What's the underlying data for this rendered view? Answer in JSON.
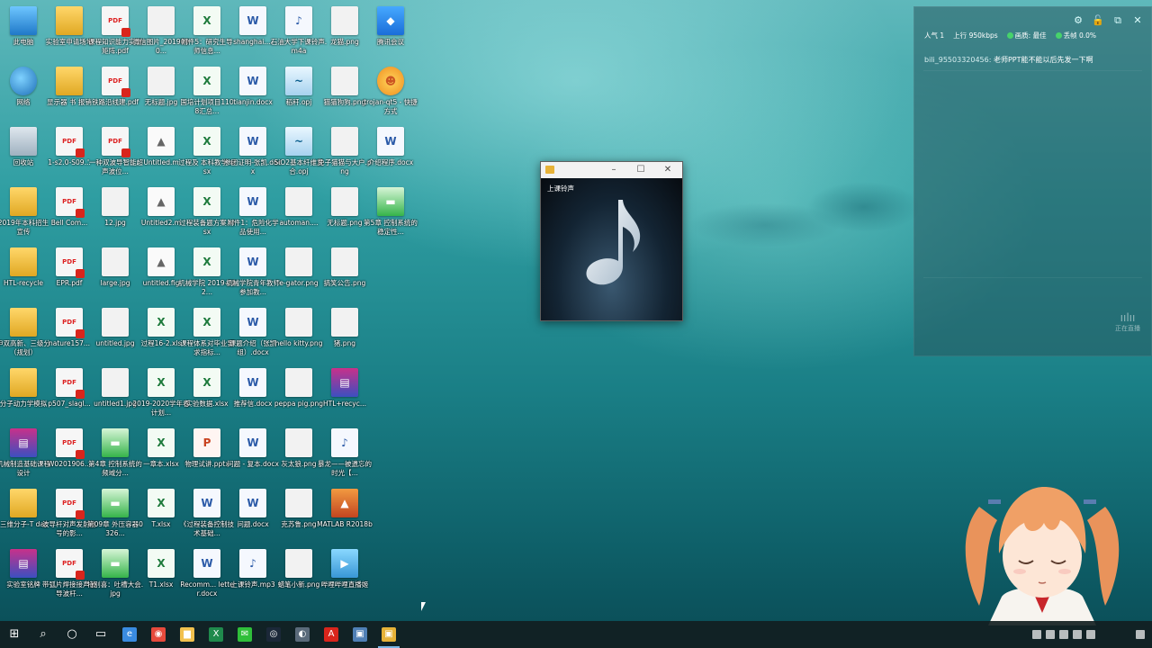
{
  "desktop": {
    "icons": [
      [
        {
          "label": "此电脑",
          "type": "pc"
        },
        {
          "label": "实验室申请场地",
          "type": "folder"
        },
        {
          "label": "课程知识能力实现矩阵.pdf",
          "type": "pdf"
        },
        {
          "label": "微信图片_2019090...",
          "type": "img"
        },
        {
          "label": "附件5：研究生导师信息...",
          "type": "xls"
        },
        {
          "label": "shanghai....",
          "type": "doc"
        },
        {
          "label": "石油大学下课铃声.m4a",
          "type": "audio"
        },
        {
          "label": "龙猫.png",
          "type": "img"
        },
        {
          "label": "腾讯会议",
          "type": "meeting"
        }
      ],
      [
        {
          "label": "网络",
          "type": "net"
        },
        {
          "label": "显示器 书 报销",
          "type": "folder"
        },
        {
          "label": "铁路沿线建.pdf",
          "type": "pdf"
        },
        {
          "label": "无标题.jpg",
          "type": "img"
        },
        {
          "label": "国培计划项目1108汇总...",
          "type": "xls"
        },
        {
          "label": "tianjin.docx",
          "type": "doc"
        },
        {
          "label": "稻秆.opj",
          "type": "opj"
        },
        {
          "label": "猫猫狗狗.png",
          "type": "img"
        },
        {
          "label": "trojan-qt5 - 快捷方式",
          "type": "trojan"
        }
      ],
      [
        {
          "label": "回收站",
          "type": "bin"
        },
        {
          "label": "1-s2.0-S09...",
          "type": "pdf"
        },
        {
          "label": "'一种双波导智能超声波位...",
          "type": "pdf"
        },
        {
          "label": "Untitled.m",
          "type": "matlabfile"
        },
        {
          "label": "过程及 本科教学.xlsx",
          "type": "xls"
        },
        {
          "label": "参团证明-张凯.docx",
          "type": "doc"
        },
        {
          "label": "SiO2基本纤维复合.opj",
          "type": "opj"
        },
        {
          "label": "免子猫猫与大户.png",
          "type": "img"
        },
        {
          "label": "介绍程序.docx",
          "type": "doc"
        }
      ],
      [
        {
          "label": "2019年本科招生宣传",
          "type": "folder"
        },
        {
          "label": "Bell Com...",
          "type": "pdf"
        },
        {
          "label": "12.jpg",
          "type": "img"
        },
        {
          "label": "Untitled2.m",
          "type": "matlabfile"
        },
        {
          "label": "过程装备题方案.xlsx",
          "type": "xls"
        },
        {
          "label": "附件1：危险化学品使用...",
          "type": "doc"
        },
        {
          "label": "automan....",
          "type": "img"
        },
        {
          "label": "无标题.png",
          "type": "img"
        },
        {
          "label": "第5章 控制系统的稳定性...",
          "type": "green"
        }
      ],
      [
        {
          "label": "HTL-recycle",
          "type": "folder"
        },
        {
          "label": "EPR.pdf",
          "type": "pdf"
        },
        {
          "label": "large.jpg",
          "type": "img"
        },
        {
          "label": "untitled.fig",
          "type": "matlabfile"
        },
        {
          "label": "机械学院 2019-202...",
          "type": "xls"
        },
        {
          "label": "机械学院青年教师参加教...",
          "type": "doc"
        },
        {
          "label": "e-gator.png",
          "type": "img"
        },
        {
          "label": "搞笑公告.png",
          "type": "img"
        },
        {
          "label": "",
          "type": "none"
        }
      ],
      [
        {
          "label": "申双高新、三级分（规划）",
          "type": "folder"
        },
        {
          "label": "nature157...",
          "type": "pdf"
        },
        {
          "label": "untitled.jpg",
          "type": "img"
        },
        {
          "label": "过程16-2.xls",
          "type": "xls"
        },
        {
          "label": "课程体系对毕业要求指标...",
          "type": "xls"
        },
        {
          "label": "课题介绍（张凯组）.docx",
          "type": "doc"
        },
        {
          "label": "hello kitty.png",
          "type": "img"
        },
        {
          "label": "猪.png",
          "type": "img"
        },
        {
          "label": "",
          "type": "none"
        }
      ],
      [
        {
          "label": "分子动力学模拟",
          "type": "folder"
        },
        {
          "label": "p507_slagl...",
          "type": "pdf"
        },
        {
          "label": "untitled1.jpg",
          "type": "img"
        },
        {
          "label": "2019-2020学年春计划...",
          "type": "xls"
        },
        {
          "label": "实验数据.xlsx",
          "type": "xls"
        },
        {
          "label": "推荐信.docx",
          "type": "doc"
        },
        {
          "label": "peppa pig.png",
          "type": "img"
        },
        {
          "label": "HTL+recyc...",
          "type": "winrar"
        },
        {
          "label": "",
          "type": "none"
        }
      ],
      [
        {
          "label": "机械制造基础课程设计",
          "type": "winrar"
        },
        {
          "label": "W0201906...",
          "type": "pdf"
        },
        {
          "label": "第4章 控制系统的频域分...",
          "type": "green"
        },
        {
          "label": "一章本.xlsx",
          "type": "xls"
        },
        {
          "label": "物理试讲.pptx",
          "type": "ppt"
        },
        {
          "label": "问题 - 复本.docx",
          "type": "doc"
        },
        {
          "label": "灰太狼.png",
          "type": "img"
        },
        {
          "label": "暴龙——被遗忘的时光【...",
          "type": "audio"
        },
        {
          "label": "",
          "type": "none"
        }
      ],
      [
        {
          "label": "三维分子-T dat",
          "type": "folder"
        },
        {
          "label": "波导杆对声发射信号的影...",
          "type": "pdf"
        },
        {
          "label": "第09章 外压容器0326...",
          "type": "green"
        },
        {
          "label": "T.xlsx",
          "type": "xls"
        },
        {
          "label": "《过程装备控制技术基础...",
          "type": "doc"
        },
        {
          "label": "问题.docx",
          "type": "doc"
        },
        {
          "label": "克苏鲁.png",
          "type": "img"
        },
        {
          "label": "MATLAB R2018b",
          "type": "matlab"
        },
        {
          "label": "",
          "type": "none"
        }
      ],
      [
        {
          "label": "实验室铭牌",
          "type": "winrar"
        },
        {
          "label": "带弧片焊接接声波导波杆...",
          "type": "pdf"
        },
        {
          "label": "特别喜：吐槽大会.jpg",
          "type": "green"
        },
        {
          "label": "T1.xlsx",
          "type": "xls"
        },
        {
          "label": "Recomm... letter.docx",
          "type": "doc"
        },
        {
          "label": "上课铃声.mp3",
          "type": "audio"
        },
        {
          "label": "蜡笔小新.png",
          "type": "img"
        },
        {
          "label": "哔哩哔哩直播姬",
          "type": "live"
        },
        {
          "label": "",
          "type": "none"
        }
      ]
    ]
  },
  "player": {
    "track": "上课铃声",
    "min": "–",
    "max": "☐",
    "close": "✕"
  },
  "stream": {
    "popularity_label": "人气",
    "popularity_value": "1",
    "upload_label": "上行",
    "upload_value": "950kbps",
    "quality_label": "画质: 最佳",
    "drop_label": "丢帧 0.0%",
    "danmaku_user": "bili_95503320456:",
    "danmaku_text": "老师PPT能不能以后先发一下啊",
    "voice_hint": "正在直播",
    "status_color": "#47d36b"
  },
  "taskbar": {
    "items": [
      "start-icon",
      "search-icon",
      "cortana-icon",
      "taskview-icon",
      "edge-icon",
      "chrome-icon",
      "file-explorer-icon",
      "excel-icon",
      "wechat-icon",
      "steam-icon",
      "media-icon",
      "acrobat-icon",
      "app-icon",
      "player-icon"
    ]
  }
}
